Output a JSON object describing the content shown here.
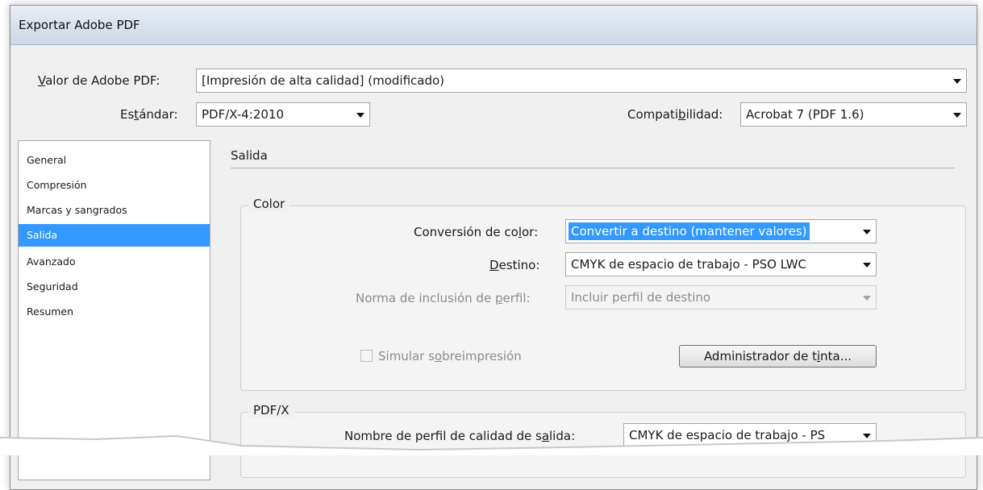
{
  "window": {
    "title": "Exportar Adobe PDF"
  },
  "header": {
    "preset_label": "Valor de Adobe PDF:",
    "preset_label_u": "V",
    "preset_label_rest": "alor de Adobe PDF:",
    "preset_value": "[Impresión de alta calidad] (modificado)",
    "standard_label_pre": "Es",
    "standard_label_u": "t",
    "standard_label_post": "ándar:",
    "standard_value": "PDF/X-4:2010",
    "compat_label_pre": "Compati",
    "compat_label_u": "b",
    "compat_label_post": "ilidad:",
    "compat_value": "Acrobat 7 (PDF 1.6)"
  },
  "sidebar": {
    "items": [
      {
        "label": "General"
      },
      {
        "label": "Compresión"
      },
      {
        "label": "Marcas y sangrados"
      },
      {
        "label": "Salida",
        "selected": true
      },
      {
        "label": "Avanzado"
      },
      {
        "label": "Seguridad"
      },
      {
        "label": "Resumen"
      }
    ]
  },
  "main": {
    "section_title": "Salida",
    "color_group": {
      "legend": "Color",
      "conversion_label_pre": "Conversión de co",
      "conversion_label_u": "l",
      "conversion_label_post": "or:",
      "conversion_value": "Convertir a destino (mantener valores)",
      "destination_label_u": "D",
      "destination_label_post": "estino:",
      "destination_value": "CMYK de espacio de trabajo - PSO LWC",
      "profile_label_pre": "Norma de inclusión de ",
      "profile_label_u": "p",
      "profile_label_post": "erfil:",
      "profile_value": "Incluir perfil de destino",
      "simulate_pre": "Simular s",
      "simulate_u": "o",
      "simulate_post": "breimpresión",
      "ink_button_pre": "Administrador de t",
      "ink_button_u": "i",
      "ink_button_post": "nta..."
    },
    "pdfx_group": {
      "legend": "PDF/X",
      "output_profile_label_pre": "Nombre de perfil de calidad de s",
      "output_profile_label_u": "a",
      "output_profile_label_post": "lida:",
      "output_profile_value": "CMYK de espacio de trabajo - PS"
    }
  },
  "colors": {
    "selection": "#3399ff",
    "dialog_bg": "#f0f0f0"
  }
}
